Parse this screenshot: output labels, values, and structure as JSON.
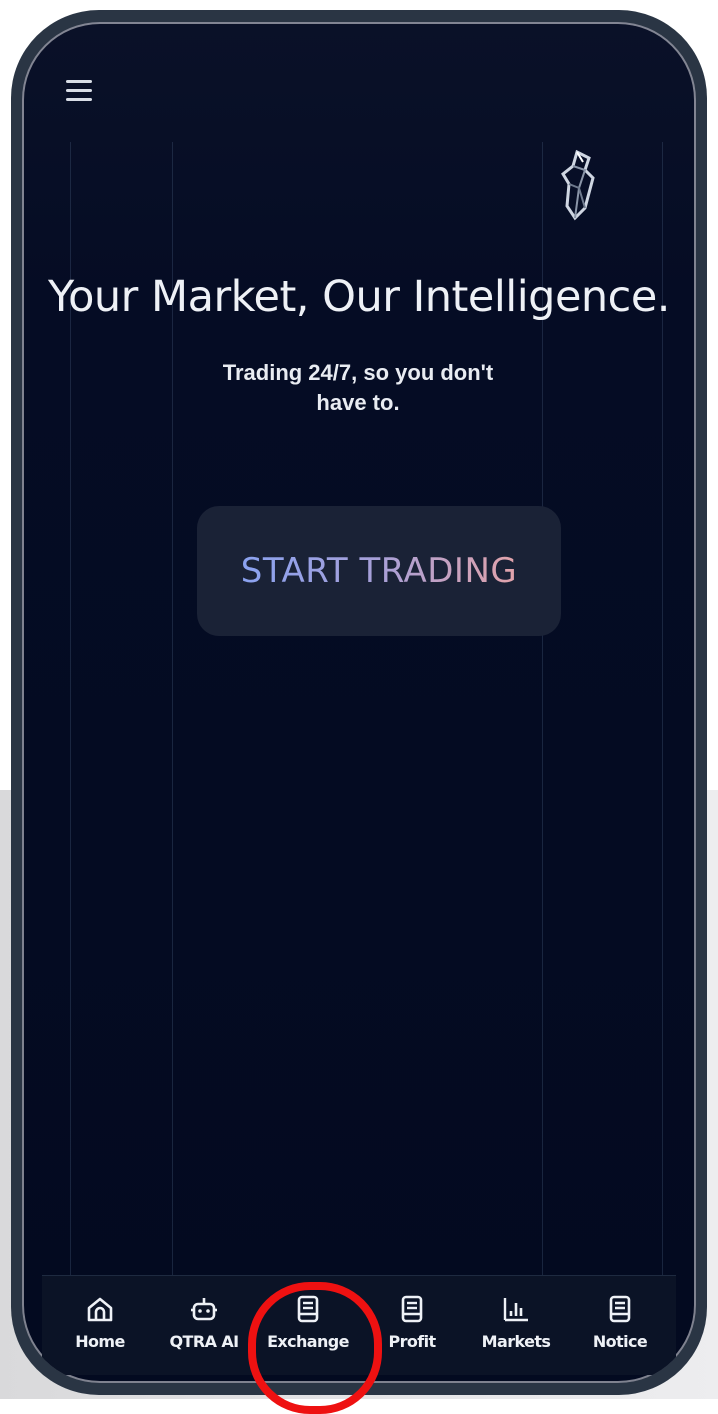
{
  "header": {
    "menu_icon": "hamburger-menu-icon",
    "logo_icon": "crystal-logo-icon"
  },
  "hero": {
    "title": "Your Market, Our Intelligence.",
    "subtitle": "Trading 24/7, so you don't have to.",
    "cta_label": "START TRADING",
    "cta_gradient": [
      "#8aa2f0",
      "#e2a3aa"
    ]
  },
  "tabbar": {
    "items": [
      {
        "label": "Home",
        "icon": "home-icon"
      },
      {
        "label": "QTRA AI",
        "icon": "robot-icon"
      },
      {
        "label": "Exchange",
        "icon": "document-icon"
      },
      {
        "label": "Profit",
        "icon": "document-icon"
      },
      {
        "label": "Markets",
        "icon": "bar-chart-icon"
      },
      {
        "label": "Notice",
        "icon": "document-icon"
      }
    ],
    "highlighted": "Exchange",
    "highlight_color": "#ee1111"
  },
  "colors": {
    "background": "#050c24",
    "frame": "#2a3544",
    "button_bg": "#1a2236"
  }
}
